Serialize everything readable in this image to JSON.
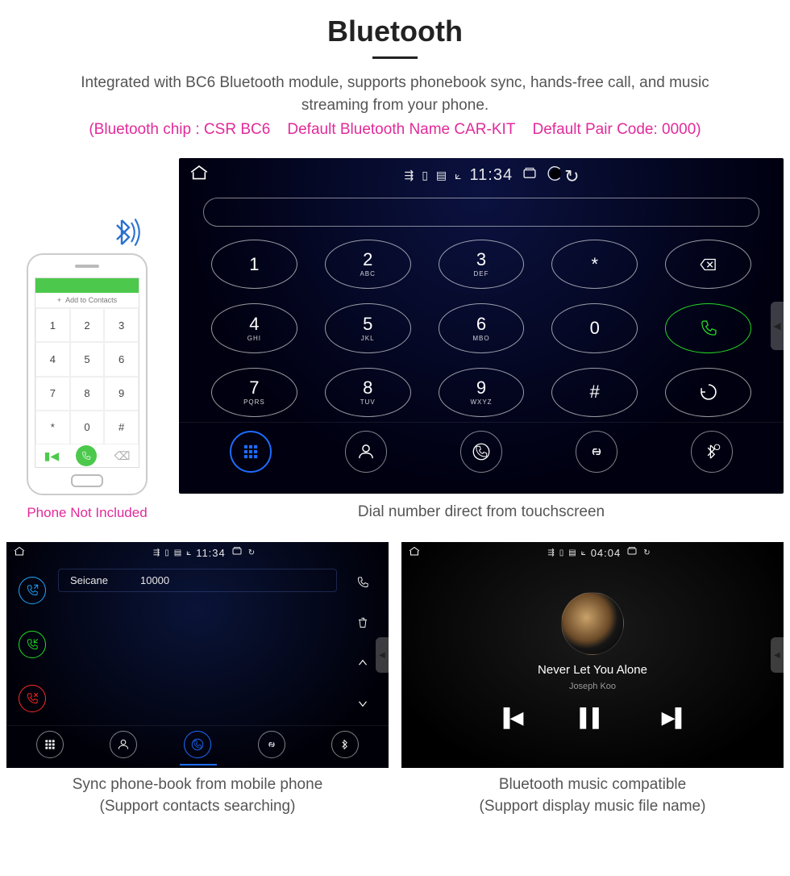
{
  "header": {
    "title": "Bluetooth",
    "description": "Integrated with BC6 Bluetooth module, supports phonebook sync, hands-free call, and music streaming from your phone.",
    "spec_line": "(Bluetooth chip : CSR BC6    Default Bluetooth Name CAR-KIT    Default Pair Code: 0000)"
  },
  "phone_mock": {
    "add_contact": "+  Add to Contacts",
    "keys": [
      "1",
      "2",
      "3",
      "4",
      "5",
      "6",
      "7",
      "8",
      "9",
      "*",
      "0",
      "#"
    ],
    "note": "Phone Not Included"
  },
  "dialer": {
    "status_time": "11:34",
    "keys": [
      {
        "n": "1",
        "s": ""
      },
      {
        "n": "2",
        "s": "ABC"
      },
      {
        "n": "3",
        "s": "DEF"
      },
      {
        "n": "*",
        "s": ""
      },
      {
        "n": "bksp",
        "s": ""
      },
      {
        "n": "4",
        "s": "GHI"
      },
      {
        "n": "5",
        "s": "JKL"
      },
      {
        "n": "6",
        "s": "MBO"
      },
      {
        "n": "0",
        "s": ""
      },
      {
        "n": "call",
        "s": ""
      },
      {
        "n": "7",
        "s": "PQRS"
      },
      {
        "n": "8",
        "s": "TUV"
      },
      {
        "n": "9",
        "s": "WXYZ"
      },
      {
        "n": "#",
        "s": ""
      },
      {
        "n": "swap",
        "s": ""
      }
    ],
    "caption": "Dial number direct from touchscreen"
  },
  "contacts": {
    "status_time": "11:34",
    "row": {
      "name": "Seicane",
      "number": "10000"
    },
    "caption_l1": "Sync phone-book from mobile phone",
    "caption_l2": "(Support contacts searching)"
  },
  "music": {
    "status_time": "04:04",
    "track": "Never Let You Alone",
    "artist": "Joseph Koo",
    "caption_l1": "Bluetooth music compatible",
    "caption_l2": "(Support display music file name)"
  }
}
